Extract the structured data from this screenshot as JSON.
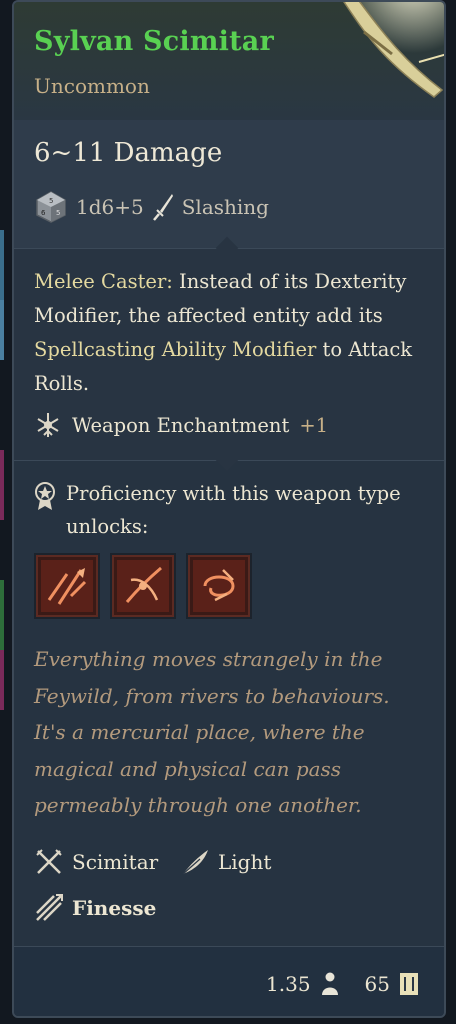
{
  "item": {
    "name": "Sylvan Scimitar",
    "rarity": "Uncommon"
  },
  "damage": {
    "title": "6~11 Damage",
    "dice": "1d6+5",
    "type": "Slashing"
  },
  "passive": {
    "name": "Melee Caster:",
    "text_before": " Instead of its Dexterity Modifier, the affected entity add its ",
    "highlight": "Spellcasting Ability Modifier",
    "text_after": " to Attack Rolls."
  },
  "enchantment": {
    "label": "Weapon Enchantment",
    "bonus": "+1"
  },
  "proficiency": {
    "text": "Proficiency with this weapon type unlocks:"
  },
  "skills": [
    {
      "name": "weapon-action-1-icon"
    },
    {
      "name": "weapon-action-2-icon"
    },
    {
      "name": "weapon-action-3-icon"
    }
  ],
  "flavor": "Everything moves strangely in the Feywild, from rivers to behaviours. It's a mercurial place, where the magical and physical can pass permeably through one another.",
  "properties": {
    "scimitar": "Scimitar",
    "light": "Light",
    "finesse": "Finesse"
  },
  "footer": {
    "weight": "1.35",
    "value": "65"
  },
  "colors": {
    "name": "#59d152",
    "rarity": "#c7b088",
    "flavor": "#b39a7d",
    "panel": "#2b3745"
  }
}
